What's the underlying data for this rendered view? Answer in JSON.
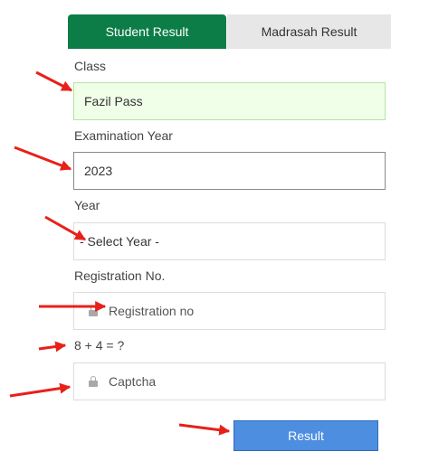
{
  "tabs": {
    "student_result": "Student Result",
    "madrasah_result": "Madrasah Result"
  },
  "form": {
    "class_label": "Class",
    "class_value": "Fazil Pass",
    "exam_year_label": "Examination Year",
    "exam_year_value": "2023",
    "year_label": "Year",
    "year_selected": "- Select Year -",
    "registration_label": "Registration No.",
    "registration_placeholder": "Registration no",
    "captcha_question": "8 + 4 = ?",
    "captcha_placeholder": "Captcha",
    "submit_label": "Result"
  },
  "colors": {
    "tab_active": "#0c7d47",
    "tab_inactive": "#e7e7e7",
    "button": "#4d8ee0",
    "arrow": "#e8201a"
  },
  "icons": [
    "lock-icon",
    "red-arrow-annotation"
  ]
}
